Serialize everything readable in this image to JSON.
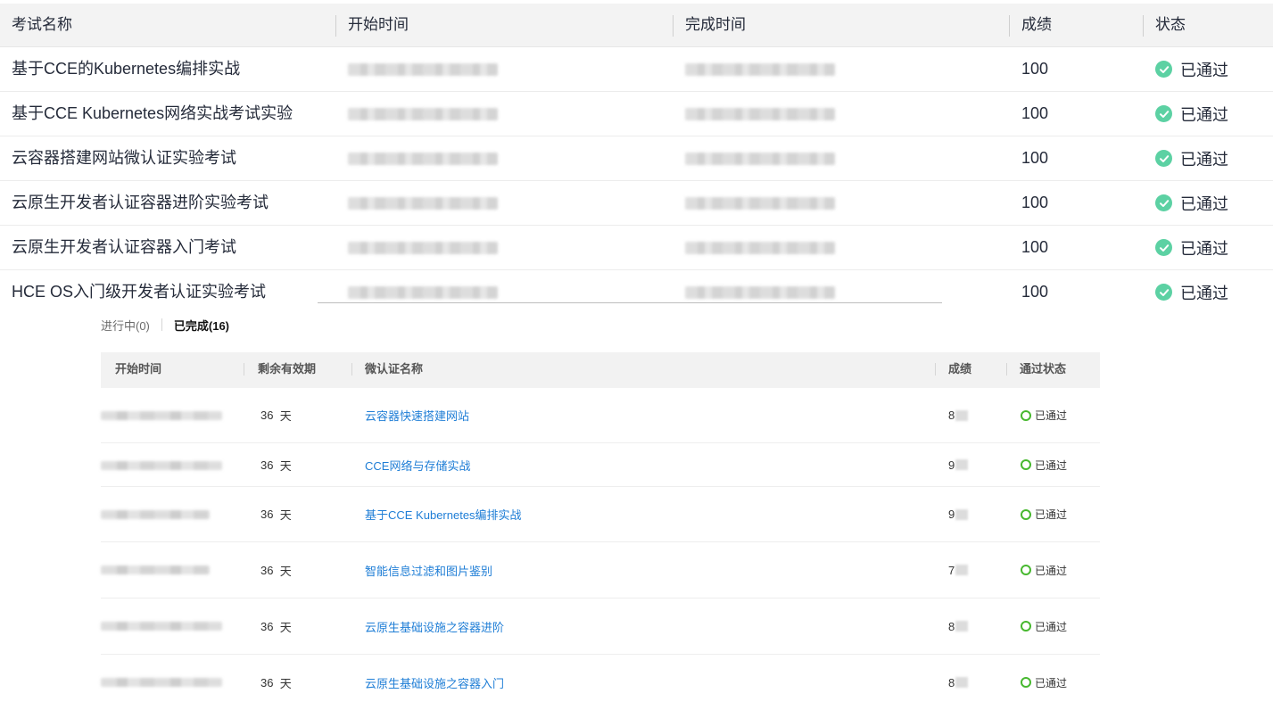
{
  "exam_table": {
    "headers": {
      "name": "考试名称",
      "start": "开始时间",
      "finish": "完成时间",
      "score": "成绩",
      "status": "状态"
    },
    "rows": [
      {
        "name": "基于CCE的Kubernetes编排实战",
        "score": "100",
        "status": "已通过"
      },
      {
        "name": "基于CCE Kubernetes网络实战考试实验",
        "score": "100",
        "status": "已通过"
      },
      {
        "name": "云容器搭建网站微认证实验考试",
        "score": "100",
        "status": "已通过"
      },
      {
        "name": "云原生开发者认证容器进阶实验考试",
        "score": "100",
        "status": "已通过"
      },
      {
        "name": "云原生开发者认证容器入门考试",
        "score": "100",
        "status": "已通过"
      },
      {
        "name": "HCE OS入门级开发者认证实验考试",
        "score": "100",
        "status": "已通过"
      }
    ],
    "status_color": "#5cd1a3"
  },
  "tabs": {
    "in_progress": "进行中(0)",
    "completed": "已完成(16)"
  },
  "cert_table": {
    "headers": {
      "start": "开始时间",
      "remaining": "剩余有效期",
      "name": "微认证名称",
      "score": "成绩",
      "status": "通过状态"
    },
    "rows": [
      {
        "remaining_prefix": "36",
        "remaining_unit": "天",
        "name": "云容器快速搭建网站",
        "score_prefix": "8",
        "status": "已通过"
      },
      {
        "remaining_prefix": "36",
        "remaining_unit": "天",
        "name": "CCE网络与存储实战",
        "score_prefix": "9",
        "status": "已通过"
      },
      {
        "remaining_prefix": "36",
        "remaining_unit": "天",
        "name": "基于CCE Kubernetes编排实战",
        "score_prefix": "9",
        "status": "已通过"
      },
      {
        "remaining_prefix": "36",
        "remaining_unit": "天",
        "name": "智能信息过滤和图片鉴别",
        "score_prefix": "7",
        "status": "已通过"
      },
      {
        "remaining_prefix": "36",
        "remaining_unit": "天",
        "name": "云原生基础设施之容器进阶",
        "score_prefix": "8",
        "status": "已通过"
      },
      {
        "remaining_prefix": "36",
        "remaining_unit": "天",
        "name": "云原生基础设施之容器入门",
        "score_prefix": "8",
        "status": "已通过"
      }
    ],
    "link_color": "#1f7ed6",
    "status_color": "#47b82f"
  }
}
